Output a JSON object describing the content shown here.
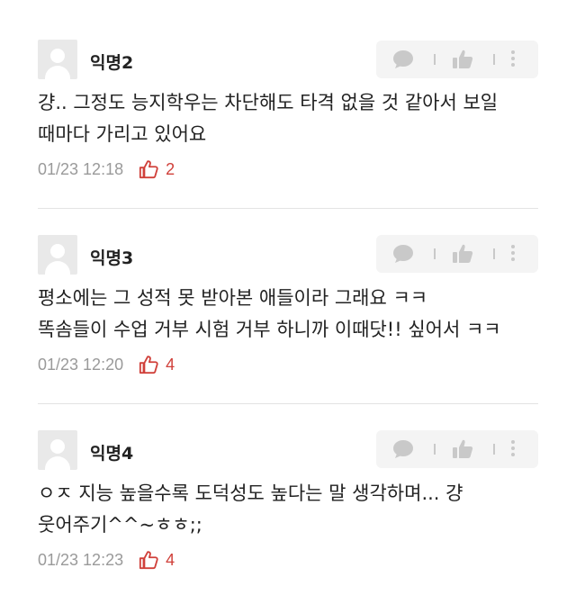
{
  "comments": [
    {
      "author": "익명2",
      "lines": [
        "걍.. 그정도 능지학우는 차단해도 타격 없을 것 같아서 보일",
        "때마다 가리고 있어요"
      ],
      "time": "01/23 12:18",
      "likes": "2"
    },
    {
      "author": "익명3",
      "lines": [
        "평소에는 그 성적 못 받아본 애들이라 그래요 ㅋㅋ",
        "똑솜들이 수업 거부 시험 거부 하니까 이때닷!! 싶어서 ㅋㅋ"
      ],
      "time": "01/23 12:20",
      "likes": "4"
    },
    {
      "author": "익명4",
      "lines": [
        "ㅇㅈ 지능 높을수록 도덕성도 높다는 말 생각하며... 걍",
        "웃어주기^^~ㅎㅎ;;"
      ],
      "time": "01/23 12:23",
      "likes": "4"
    }
  ],
  "icons": {
    "avatar": "anonymous-user-icon",
    "reply": "chat-bubble-icon",
    "like": "thumbs-up-icon",
    "more": "more-vertical-icon",
    "comment_like": "thumbs-up-outline-icon"
  },
  "colors": {
    "like_accent": "#d0403a",
    "muted_text": "#9a9a9a",
    "action_bg": "#f4f4f4",
    "action_icon": "#c9c9c9"
  }
}
